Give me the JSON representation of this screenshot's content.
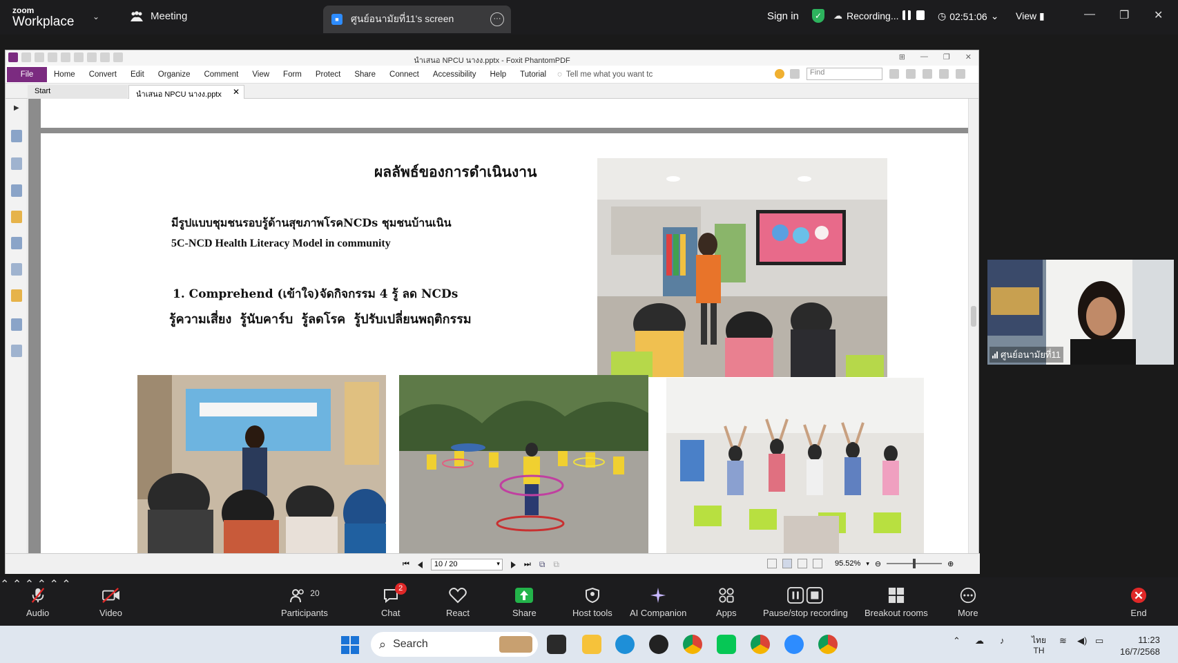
{
  "zoom": {
    "brand_small": "zoom",
    "brand_big": "Workplace",
    "meeting_label": "Meeting",
    "share_tab_label": "ศูนย์อนามัยที่11's screen",
    "sign_in": "Sign in",
    "recording_label": "Recording...",
    "timer": "02:51:06",
    "view_label": "View"
  },
  "foxit": {
    "window_title": "นำเสนอ NPCU นางง.pptx - Foxit PhantomPDF",
    "menu": [
      "Home",
      "Convert",
      "Edit",
      "Organize",
      "Comment",
      "View",
      "Form",
      "Protect",
      "Share",
      "Connect",
      "Accessibility",
      "Help",
      "Tutorial"
    ],
    "file_label": "File",
    "tell_me": "Tell me what you want tc",
    "find_placeholder": "Find",
    "tab_start": "Start",
    "tab_doc": "นำเสนอ NPCU นางง.pptx",
    "page_field": "10 / 20",
    "zoom_level": "95.52%"
  },
  "slide": {
    "title": "ผลลัพธ์ของการดำเนินงาน",
    "line1": "มีรูปแบบชุมชนรอบรู้ด้านสุขภาพโรคNCDs ชุมชนบ้านเนิน",
    "line2": "5C-NCD Health Literacy Model in community",
    "line3": "1. Comprehend (เข้าใจ)จัดกิจกรรม 4 รู้ ลด NCDs",
    "line4": "รู้ความเสี่ยง  รู้นับคาร์บ  รู้ลดโรค  รู้ปรับเปลี่ยนพฤติกรรม"
  },
  "participant": {
    "name": "ศูนย์อนามัยที่11"
  },
  "toolbar": {
    "audio": "Audio",
    "video": "Video",
    "participants": "Participants",
    "participants_count": "20",
    "chat": "Chat",
    "chat_badge": "2",
    "react": "React",
    "share": "Share",
    "host_tools": "Host tools",
    "ai_companion": "AI Companion",
    "apps": "Apps",
    "pause_stop": "Pause/stop recording",
    "breakout": "Breakout rooms",
    "more": "More",
    "end": "End"
  },
  "taskbar": {
    "search": "Search",
    "lang_top": "ไทย",
    "lang_bottom": "TH",
    "time": "11:23",
    "date": "16/7/2568"
  },
  "colors": {
    "zoom_bg": "#1c1c1e",
    "foxit_accent": "#7b2b80",
    "zoom_blue": "#2d8cff",
    "end_red": "#e02828"
  }
}
